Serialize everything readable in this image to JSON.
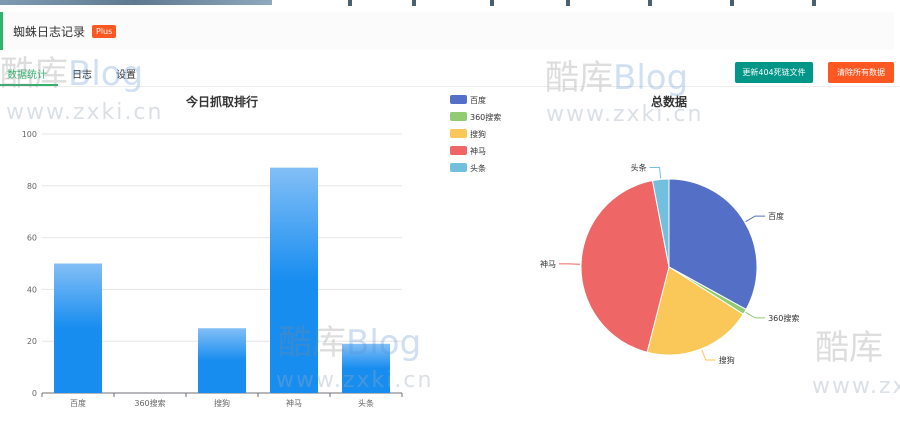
{
  "header": {
    "title": "蜘蛛日志记录",
    "badge": "Plus"
  },
  "tabs": [
    {
      "label": "数据统计",
      "active": true
    },
    {
      "label": "日志",
      "active": false
    },
    {
      "label": "设置",
      "active": false
    }
  ],
  "buttons": {
    "update_404": "更新404死链文件",
    "clear_all": "清除所有数据"
  },
  "watermark": {
    "brand_cn": "酷库",
    "brand_en": "Blog",
    "url": "www.zxki.cn"
  },
  "colors": {
    "accent": "#2fb36d",
    "button_green": "#009688",
    "button_red": "#ff5722",
    "bar": "#1a8cf0"
  },
  "legend": [
    {
      "name": "百度",
      "color": "#5470c6"
    },
    {
      "name": "360搜索",
      "color": "#91cc75"
    },
    {
      "name": "搜狗",
      "color": "#fac858"
    },
    {
      "name": "神马",
      "color": "#ee6666"
    },
    {
      "name": "头条",
      "color": "#73c0de"
    }
  ],
  "chart_data": [
    {
      "type": "bar",
      "title": "今日抓取排行",
      "categories": [
        "百度",
        "360搜索",
        "搜狗",
        "神马",
        "头条"
      ],
      "values": [
        50,
        0,
        25,
        87,
        19
      ],
      "ylim": [
        0,
        100
      ],
      "yticks": [
        0,
        20,
        40,
        60,
        80,
        100
      ],
      "grid": true
    },
    {
      "type": "pie",
      "title": "总数据",
      "labels": [
        "百度",
        "360搜索",
        "搜狗",
        "神马",
        "头条"
      ],
      "values": [
        33,
        1,
        20,
        43,
        3
      ],
      "colors": [
        "#5470c6",
        "#91cc75",
        "#fac858",
        "#ee6666",
        "#73c0de"
      ]
    }
  ]
}
